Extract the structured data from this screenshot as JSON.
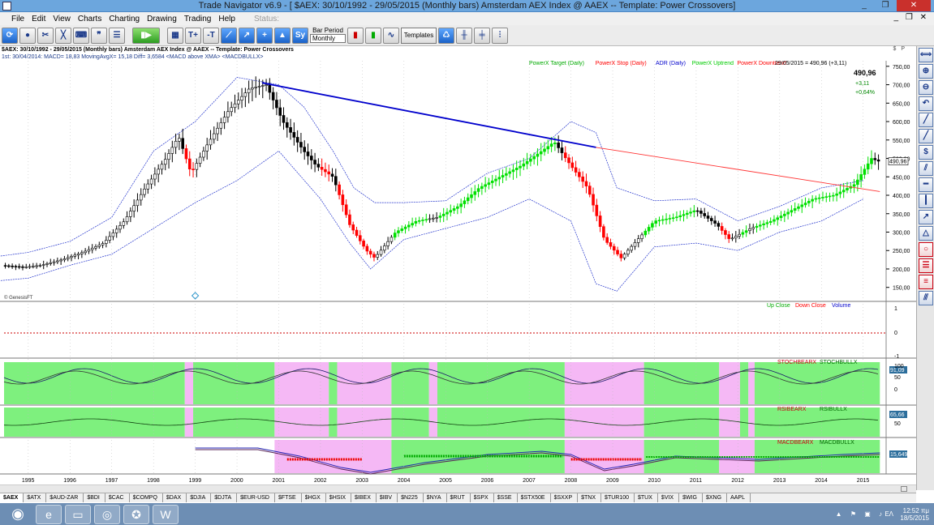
{
  "window": {
    "title": "Trade Navigator v6.9 - [ $AEX:  30/10/1992 - 29/05/2015  (Monthly bars)   Amsterdam AEX Index @ AAEX  --  Template: Power Crossovers]",
    "buttons": [
      "_",
      "❐",
      "✕"
    ]
  },
  "menu": {
    "items": [
      "File",
      "Edit",
      "View",
      "Charts",
      "Charting",
      "Drawing",
      "Trading",
      "Help"
    ],
    "status": "Status:"
  },
  "toolbar": {
    "bar_period_label": "Bar Period",
    "bar_period_value": "Monthly",
    "templates_label": "Templates"
  },
  "info": {
    "line1": "$AEX:  30/10/1992 - 29/05/2015  (Monthly bars)   Amsterdam AEX Index @ AAEX  --  Template: Power Crossovers",
    "line2": "1st:  30/04/2014:   MACD= 18,83  MovingAvgX= 15,18  Diff= 3,6584   <MACD above XMA>   <MACDBULLX>",
    "sp": "$ P"
  },
  "chart_data": {
    "type": "candlestick",
    "legend": [
      {
        "label": "PowerX Target (Daily)",
        "color": "#00aa00"
      },
      {
        "label": "PowerX Stop (Daily)",
        "color": "#ff0000"
      },
      {
        "label": "ADR (Daily)",
        "color": "#0000cc"
      },
      {
        "label": "PowerX Uptrend",
        "color": "#00cc00"
      },
      {
        "label": "PowerX Downtrend",
        "color": "#ff0000"
      }
    ],
    "last_bar": "29/05/2015 = 490,96 (+3,11)",
    "last_price": "490,96",
    "change": "+3,11",
    "change_pct": "+0,64%",
    "price_label": "490,96",
    "y_ticks": [
      "750,00",
      "700,00",
      "650,00",
      "600,00",
      "550,00",
      "500,00",
      "450,00",
      "400,00",
      "350,00",
      "300,00",
      "250,00",
      "200,00",
      "150,00"
    ],
    "y_tick_values": [
      750,
      700,
      650,
      600,
      550,
      500,
      450,
      400,
      350,
      300,
      250,
      200,
      150
    ],
    "ylim": [
      112,
      765
    ],
    "x_ticks": [
      "1995",
      "1996",
      "1997",
      "1998",
      "1999",
      "2000",
      "2001",
      "2002",
      "2003",
      "2004",
      "2005",
      "2006",
      "2007",
      "2008",
      "2009",
      "2010",
      "2011",
      "2012",
      "2013",
      "2014",
      "2015"
    ],
    "x_tick_values": [
      1995,
      1996,
      1997,
      1998,
      1999,
      2000,
      2001,
      2002,
      2003,
      2004,
      2005,
      2006,
      2007,
      2008,
      2009,
      2010,
      2011,
      2012,
      2013,
      2014,
      2015
    ],
    "xlim": [
      1994.42,
      2015.55
    ],
    "series": [
      {
        "name": "AEX",
        "points": [
          [
            1992.9,
            185
          ],
          [
            1993.3,
            190
          ],
          [
            1993.8,
            200
          ],
          [
            1994.3,
            210
          ],
          [
            1994.9,
            205
          ],
          [
            1995.3,
            210
          ],
          [
            1995.8,
            225
          ],
          [
            1996.3,
            245
          ],
          [
            1996.8,
            270
          ],
          [
            1997.3,
            330
          ],
          [
            1997.8,
            420
          ],
          [
            1998.3,
            500
          ],
          [
            1998.6,
            560
          ],
          [
            1998.9,
            460
          ],
          [
            1999.3,
            540
          ],
          [
            1999.8,
            630
          ],
          [
            2000.3,
            690
          ],
          [
            2000.7,
            700
          ],
          [
            2001.1,
            600
          ],
          [
            2001.6,
            520
          ],
          [
            2001.9,
            480
          ],
          [
            2002.3,
            450
          ],
          [
            2002.7,
            320
          ],
          [
            2003.1,
            250
          ],
          [
            2003.3,
            230
          ],
          [
            2003.8,
            300
          ],
          [
            2004.3,
            330
          ],
          [
            2004.8,
            340
          ],
          [
            2005.3,
            370
          ],
          [
            2005.8,
            420
          ],
          [
            2006.3,
            450
          ],
          [
            2006.8,
            480
          ],
          [
            2007.3,
            520
          ],
          [
            2007.6,
            545
          ],
          [
            2008.0,
            480
          ],
          [
            2008.4,
            420
          ],
          [
            2008.8,
            280
          ],
          [
            2009.2,
            230
          ],
          [
            2009.6,
            280
          ],
          [
            2010.0,
            330
          ],
          [
            2010.5,
            340
          ],
          [
            2011.0,
            360
          ],
          [
            2011.5,
            320
          ],
          [
            2011.8,
            280
          ],
          [
            2012.3,
            310
          ],
          [
            2012.8,
            330
          ],
          [
            2013.3,
            360
          ],
          [
            2013.8,
            390
          ],
          [
            2014.3,
            400
          ],
          [
            2014.8,
            430
          ],
          [
            2015.2,
            500
          ],
          [
            2015.4,
            490.96
          ]
        ]
      },
      {
        "name": "ADR Upper",
        "points": [
          [
            1993,
            225
          ],
          [
            1994,
            230
          ],
          [
            1995,
            245
          ],
          [
            1996,
            275
          ],
          [
            1997,
            340
          ],
          [
            1998,
            520
          ],
          [
            1999,
            600
          ],
          [
            2000,
            720
          ],
          [
            2001,
            700
          ],
          [
            2001.6,
            640
          ],
          [
            2002.3,
            520
          ],
          [
            2002.8,
            420
          ],
          [
            2003.3,
            380
          ],
          [
            2004,
            380
          ],
          [
            2005,
            385
          ],
          [
            2006,
            460
          ],
          [
            2007,
            500
          ],
          [
            2008,
            600
          ],
          [
            2008.6,
            570
          ],
          [
            2009.1,
            420
          ],
          [
            2010,
            385
          ],
          [
            2011,
            390
          ],
          [
            2012,
            330
          ],
          [
            2013,
            370
          ],
          [
            2014,
            420
          ],
          [
            2015,
            440
          ]
        ]
      },
      {
        "name": "ADR Lower",
        "points": [
          [
            1993,
            160
          ],
          [
            1994,
            165
          ],
          [
            1995,
            175
          ],
          [
            1996,
            210
          ],
          [
            1997,
            240
          ],
          [
            1998,
            310
          ],
          [
            1999,
            380
          ],
          [
            2000,
            440
          ],
          [
            2001,
            520
          ],
          [
            2002,
            390
          ],
          [
            2002.7,
            270
          ],
          [
            2003.2,
            200
          ],
          [
            2004,
            280
          ],
          [
            2005,
            310
          ],
          [
            2006,
            340
          ],
          [
            2007,
            390
          ],
          [
            2008,
            330
          ],
          [
            2008.6,
            160
          ],
          [
            2009.1,
            140
          ],
          [
            2010,
            260
          ],
          [
            2011,
            270
          ],
          [
            2012,
            250
          ],
          [
            2013,
            300
          ],
          [
            2014,
            330
          ],
          [
            2015,
            390
          ]
        ]
      }
    ],
    "trendlines": [
      {
        "name": "blue",
        "color": "#0000cc",
        "points": [
          [
            2000.6,
            705
          ],
          [
            2008.6,
            530
          ]
        ]
      },
      {
        "name": "red",
        "color": "#ff3333",
        "points": [
          [
            2008.6,
            530
          ],
          [
            2015.4,
            410
          ]
        ]
      }
    ],
    "panels": [
      {
        "name": "volume",
        "legend": [
          "Up Close",
          "Down Close",
          "Volume"
        ],
        "legend_colors": [
          "#00aa00",
          "#ff0000",
          "#0000cc"
        ],
        "ticks": [
          "1",
          "0",
          "-1"
        ],
        "value": "0"
      },
      {
        "name": "stoch",
        "legend": [
          "STOCHBEARX",
          "STOCHBULLX"
        ],
        "value": "91,09",
        "ticks": [
          "100",
          "50",
          "0"
        ]
      },
      {
        "name": "rsi",
        "legend": [
          "RSIBEARX",
          "RSIBULLX"
        ],
        "value": "65,66",
        "ticks": [
          "50"
        ]
      },
      {
        "name": "macd",
        "legend": [
          "MACDBEARX",
          "MACDBULLX"
        ],
        "value": "15,649"
      }
    ]
  },
  "watermark": "© GenesisFT",
  "sheet_tabs": [
    "$AEX",
    "$ATX",
    "$AUD-ZAR",
    "$BDI",
    "$CAC",
    "$COMPQ",
    "$DAX",
    "$DJIA",
    "$DJTA",
    "$EUR-USD",
    "$FTSE",
    "$HGX",
    "$HSIX",
    "$IBEX",
    "$IBV",
    "$N225",
    "$NYA",
    "$RUT",
    "$SPX",
    "$SSE",
    "$STX50E",
    "$SXXP",
    "$TNX",
    "$TUR100",
    "$TUX",
    "$VIX",
    "$WIG",
    "$XNG",
    "AAPL"
  ],
  "taskbar": {
    "clock": "12:52 πμ",
    "date": "18/5/2015",
    "lang": "EΛ"
  },
  "colors": {
    "up": "#00e000",
    "down": "#ff0000",
    "neutral": "#000000",
    "bull_bg": "#7ef07e",
    "bear_bg": "#f5b8f5"
  }
}
